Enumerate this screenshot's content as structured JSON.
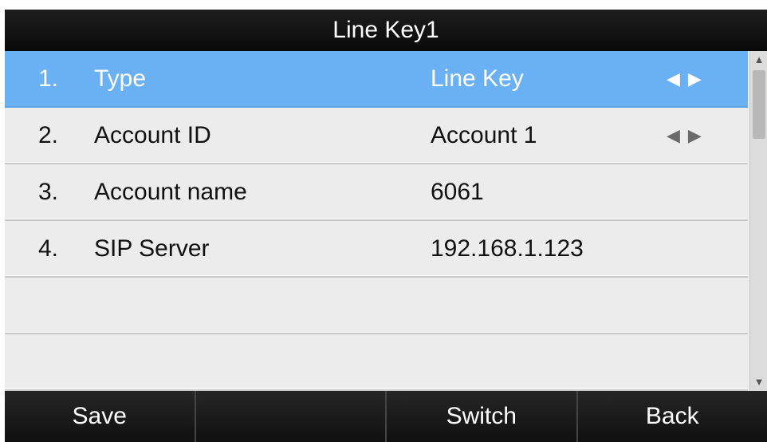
{
  "title": "Line Key1",
  "rows": [
    {
      "num": "1.",
      "label": "Type",
      "value": "Line Key",
      "selected": true,
      "has_arrows": true
    },
    {
      "num": "2.",
      "label": "Account ID",
      "value": "Account 1",
      "selected": false,
      "has_arrows": true
    },
    {
      "num": "3.",
      "label": "Account name",
      "value": "6061",
      "selected": false,
      "has_arrows": false
    },
    {
      "num": "4.",
      "label": "SIP Server",
      "value": "192.168.1.123",
      "selected": false,
      "has_arrows": false
    },
    {
      "num": "",
      "label": "",
      "value": "",
      "selected": false,
      "has_arrows": false
    },
    {
      "num": "",
      "label": "",
      "value": "",
      "selected": false,
      "has_arrows": false
    }
  ],
  "arrows": {
    "left": "◀",
    "right": "▶"
  },
  "scrollbar": {
    "up_icon": "▲",
    "down_icon": "▼"
  },
  "softkeys": [
    "Save",
    "",
    "Switch",
    "Back"
  ],
  "colors": {
    "selected_row": "#6ab0f4",
    "bar_background": "#0a0a0a",
    "row_background": "#ececec"
  }
}
